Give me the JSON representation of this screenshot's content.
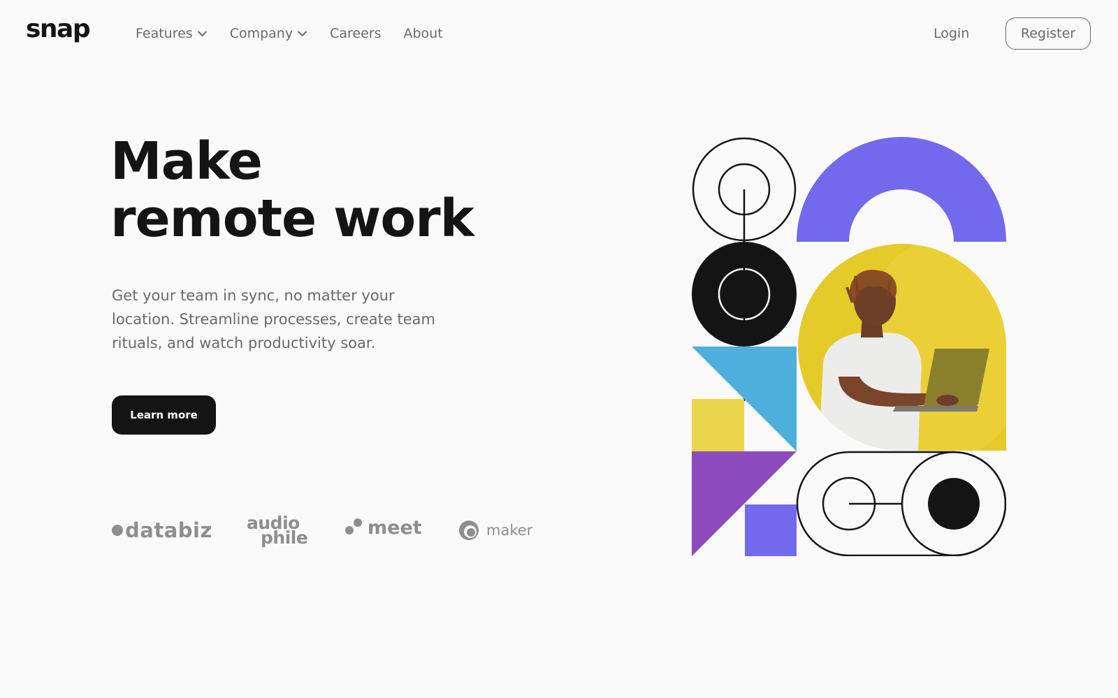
{
  "header": {
    "logo": "snap",
    "nav": [
      {
        "label": "Features",
        "has_dropdown": true
      },
      {
        "label": "Company",
        "has_dropdown": true
      },
      {
        "label": "Careers",
        "has_dropdown": false
      },
      {
        "label": "About",
        "has_dropdown": false
      }
    ],
    "login_label": "Login",
    "register_label": "Register"
  },
  "hero": {
    "headline_line1": "Make",
    "headline_line2": "remote work",
    "description": "Get your team in sync, no matter your location. Streamline processes, create team rituals, and watch productivity soar.",
    "cta_label": "Learn more"
  },
  "clients": {
    "databiz": "databiz",
    "audiophile_line1": "audio",
    "audiophile_line2": "phile",
    "meet": "meet",
    "maker": "maker"
  },
  "colors": {
    "background": "#fafafa",
    "text_dark": "#141414",
    "text_gray": "#696969",
    "purple": "#7369ed",
    "blue": "#4fb0dd",
    "yellow": "#ebd64d",
    "violet": "#8d4bbf",
    "photo_bg": "#e4cb2a"
  },
  "icons": [
    "chevron-down-icon",
    "databiz-logo",
    "audiophile-logo",
    "meet-logo",
    "maker-logo",
    "hero-illustration"
  ]
}
